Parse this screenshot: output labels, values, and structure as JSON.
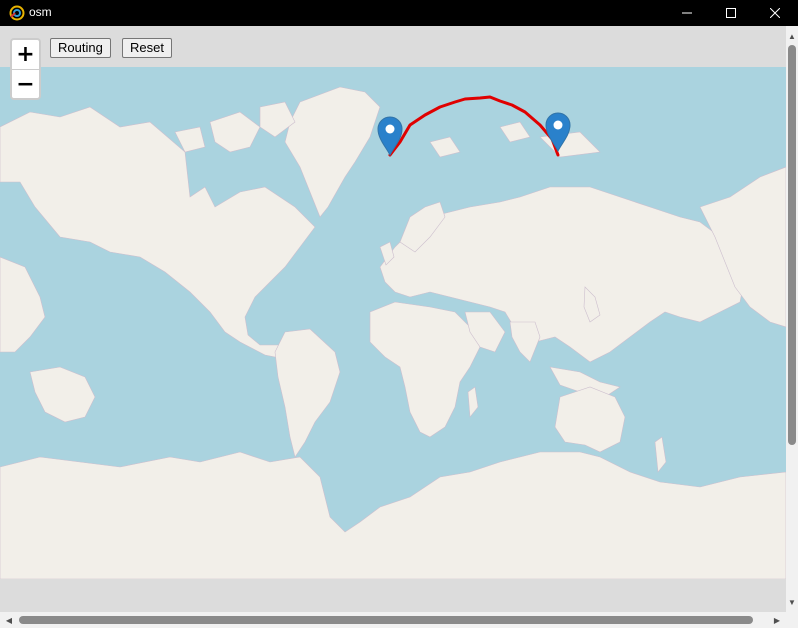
{
  "window": {
    "title": "osm",
    "icons": {
      "app": "osm-app-icon",
      "minimize": "minimize-icon",
      "maximize": "maximize-icon",
      "close": "close-icon"
    }
  },
  "map": {
    "zoom_in": "+",
    "zoom_out": "−",
    "routing_label": "Routing",
    "reset_label": "Reset",
    "route_color": "#e00000",
    "marker_color": "#2a81cb",
    "water_color": "#aad3df",
    "land_color": "#f2efe9"
  }
}
